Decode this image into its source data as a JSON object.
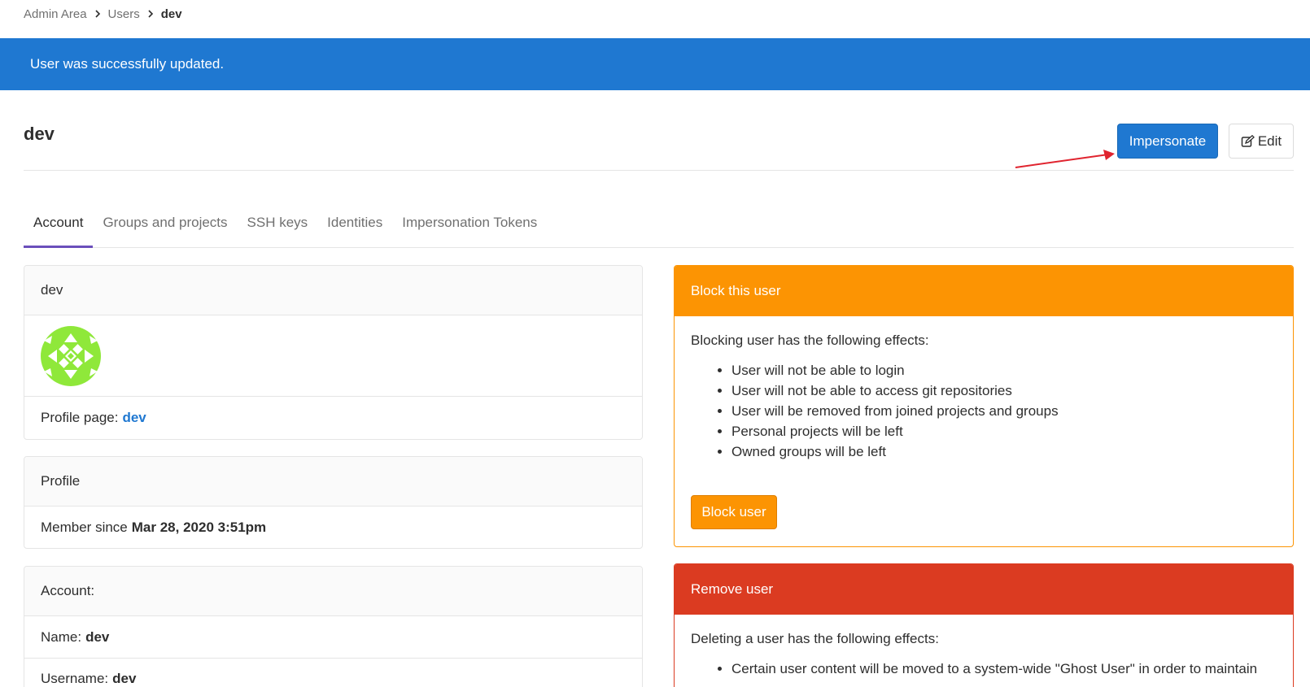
{
  "breadcrumb": {
    "items": [
      "Admin Area",
      "Users"
    ],
    "current": "dev"
  },
  "flash": {
    "message": "User was successfully updated."
  },
  "header": {
    "title": "dev",
    "impersonate_label": "Impersonate",
    "edit_label": "Edit"
  },
  "tabs": [
    {
      "label": "Account",
      "active": true
    },
    {
      "label": "Groups and projects",
      "active": false
    },
    {
      "label": "SSH keys",
      "active": false
    },
    {
      "label": "Identities",
      "active": false
    },
    {
      "label": "Impersonation Tokens",
      "active": false
    }
  ],
  "user_card": {
    "title": "dev",
    "profile_label": "Profile page:",
    "profile_link": "dev"
  },
  "profile_card": {
    "title": "Profile",
    "member_since_label": "Member since",
    "member_since_value": "Mar 28, 2020 3:51pm"
  },
  "account_card": {
    "title": "Account:",
    "name_label": "Name:",
    "name_value": "dev",
    "username_label": "Username:",
    "username_value": "dev"
  },
  "block_panel": {
    "title": "Block this user",
    "intro": "Blocking user has the following effects:",
    "effects": [
      "User will not be able to login",
      "User will not be able to access git repositories",
      "User will be removed from joined projects and groups",
      "Personal projects will be left",
      "Owned groups will be left"
    ],
    "button_label": "Block user"
  },
  "remove_panel": {
    "title": "Remove user",
    "intro": "Deleting a user has the following effects:",
    "effects": [
      "Certain user content will be moved to a system-wide \"Ghost User\" in order to maintain"
    ]
  },
  "colors": {
    "primary": "#1f78d1",
    "warning": "#fc9403",
    "danger": "#db3b21",
    "tab_active": "#6b4fbb",
    "avatar": "#8fe83a"
  }
}
